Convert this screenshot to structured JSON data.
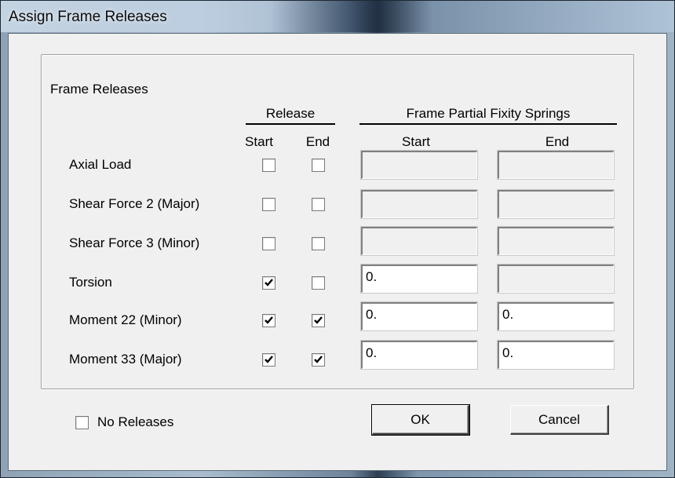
{
  "window": {
    "title": "Assign Frame Releases"
  },
  "group": {
    "title": "Frame Releases"
  },
  "headers": {
    "release": "Release",
    "release_start": "Start",
    "release_end": "End",
    "springs": "Frame Partial Fixity Springs",
    "springs_start": "Start",
    "springs_end": "End"
  },
  "rows": [
    {
      "label": "Axial Load",
      "release_start": false,
      "release_end": false,
      "spring_start": "",
      "spring_end": "",
      "spring_start_enabled": false,
      "spring_end_enabled": false
    },
    {
      "label": "Shear Force 2 (Major)",
      "release_start": false,
      "release_end": false,
      "spring_start": "",
      "spring_end": "",
      "spring_start_enabled": false,
      "spring_end_enabled": false
    },
    {
      "label": "Shear Force 3 (Minor)",
      "release_start": false,
      "release_end": false,
      "spring_start": "",
      "spring_end": "",
      "spring_start_enabled": false,
      "spring_end_enabled": false
    },
    {
      "label": "Torsion",
      "release_start": true,
      "release_end": false,
      "spring_start": "0.",
      "spring_end": "",
      "spring_start_enabled": true,
      "spring_end_enabled": false
    },
    {
      "label": "Moment 22 (Minor)",
      "release_start": true,
      "release_end": true,
      "spring_start": "0.",
      "spring_end": "0.",
      "spring_start_enabled": true,
      "spring_end_enabled": true
    },
    {
      "label": "Moment 33 (Major)",
      "release_start": true,
      "release_end": true,
      "spring_start": "0.",
      "spring_end": "0.",
      "spring_start_enabled": true,
      "spring_end_enabled": true
    }
  ],
  "no_releases": {
    "label": "No Releases",
    "checked": false
  },
  "buttons": {
    "ok": "OK",
    "cancel": "Cancel"
  }
}
